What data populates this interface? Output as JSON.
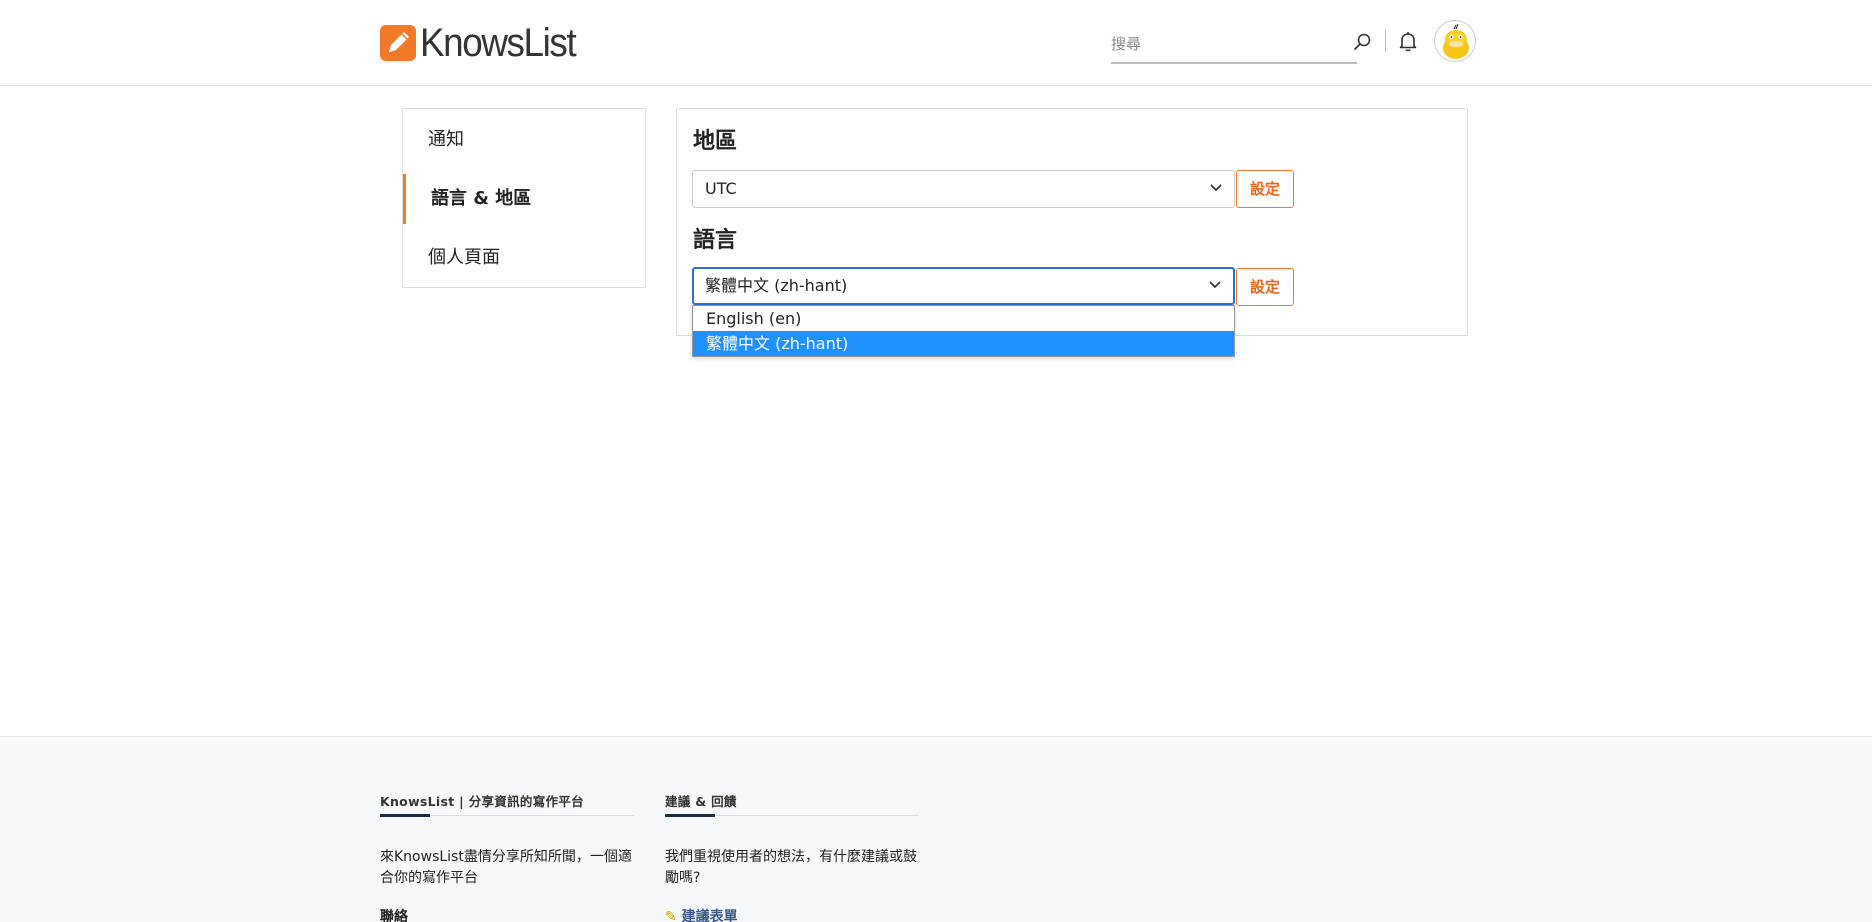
{
  "header": {
    "logo_text": "KnowsList",
    "search_placeholder": "搜尋"
  },
  "sidebar": {
    "items": [
      {
        "label": "通知",
        "active": false
      },
      {
        "label": "語言 & 地區",
        "active": true
      },
      {
        "label": "個人頁面",
        "active": false
      }
    ]
  },
  "main": {
    "region": {
      "title": "地區",
      "selected": "UTC",
      "button": "設定"
    },
    "language": {
      "title": "語言",
      "selected": "繁體中文 (zh-hant)",
      "button": "設定",
      "options": [
        {
          "label": "English (en)",
          "selected": false
        },
        {
          "label": "繁體中文 (zh-hant)",
          "selected": true
        }
      ]
    }
  },
  "footer": {
    "col1": {
      "heading": "KnowsList | 分享資訊的寫作平台",
      "text": "來KnowsList盡情分享所知所聞，一個適合你的寫作平台",
      "sub": "聯絡"
    },
    "col2": {
      "heading": "建議 & 回饋",
      "text": "我們重視使用者的想法，有什麼建議或鼓勵嗎?",
      "link": "建議表單"
    }
  },
  "colors": {
    "accent": "#f07a2a",
    "selected_option": "#1e90ff",
    "focus_border": "#2f6fd8"
  }
}
